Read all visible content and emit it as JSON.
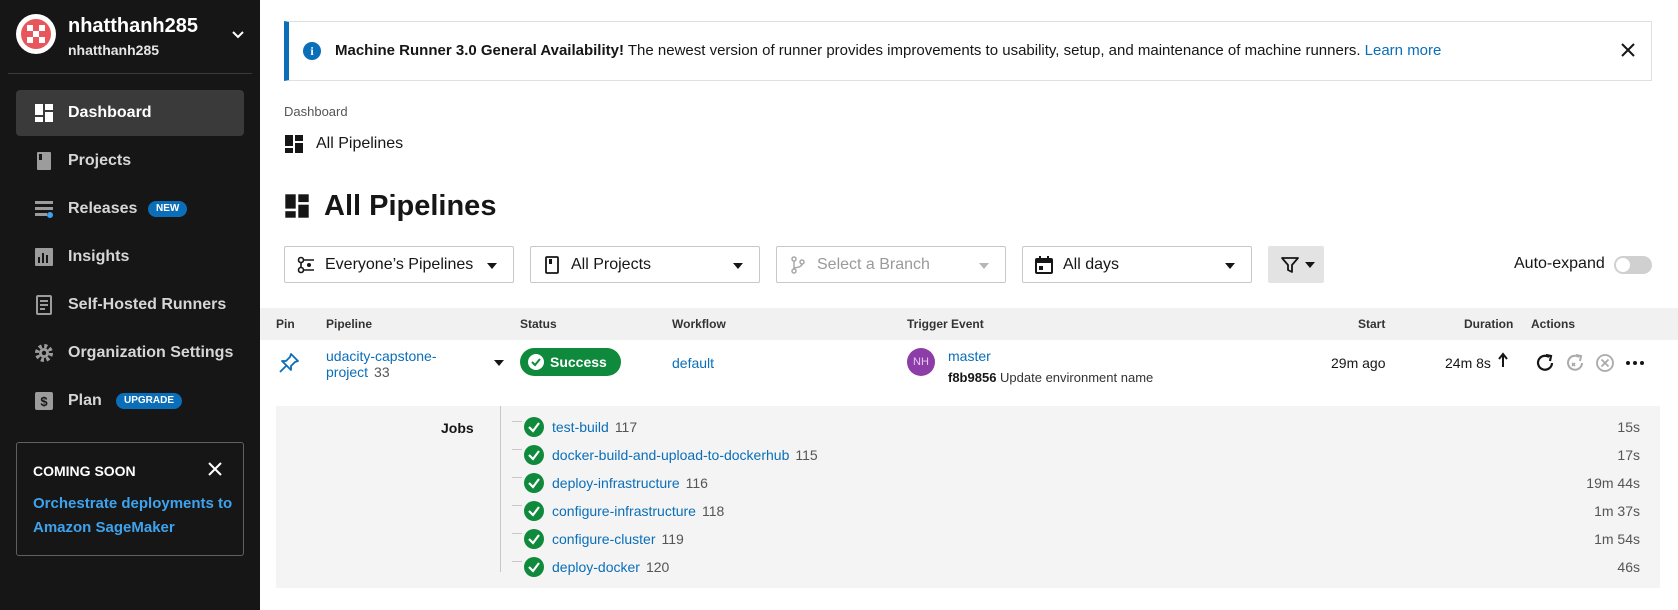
{
  "org": {
    "name": "nhatthanh285",
    "sub": "nhatthanh285"
  },
  "sidebar": {
    "items": [
      {
        "label": "Dashboard",
        "icon": "dashboard-icon",
        "active": true
      },
      {
        "label": "Projects",
        "icon": "book-icon"
      },
      {
        "label": "Releases",
        "icon": "releases-icon",
        "badge": "NEW"
      },
      {
        "label": "Insights",
        "icon": "chart-icon"
      },
      {
        "label": "Self-Hosted Runners",
        "icon": "runner-icon"
      },
      {
        "label": "Organization Settings",
        "icon": "gear-icon"
      },
      {
        "label": "Plan",
        "icon": "dollar-icon",
        "badge": "UPGRADE"
      }
    ],
    "coming_soon": {
      "title": "COMING SOON",
      "link": "Orchestrate deployments to Amazon SageMaker"
    }
  },
  "banner": {
    "bold": "Machine Runner 3.0 General Availability!",
    "text": " The newest version of runner provides improvements to usability, setup, and maintenance of machine runners. ",
    "link": "Learn more"
  },
  "breadcrumb": "Dashboard",
  "sub_title": "All Pipelines",
  "page_title": "All Pipelines",
  "filters": {
    "pipelines": "Everyone’s Pipelines",
    "projects": "All Projects",
    "branch_placeholder": "Select a Branch",
    "days": "All days"
  },
  "auto_expand": {
    "label": "Auto-expand",
    "on": false
  },
  "table": {
    "headers": [
      "Pin",
      "Pipeline",
      "Status",
      "Workflow",
      "Trigger Event",
      "Start",
      "Duration",
      "Actions"
    ],
    "row": {
      "pipeline": "udacity-capstone-project",
      "number": "33",
      "status": "Success",
      "workflow": "default",
      "avatar": "NH",
      "branch": "master",
      "commit_sha": "f8b9856",
      "commit_msg": "Update environment name",
      "start": "29m ago",
      "duration": "24m 8s"
    }
  },
  "jobs": {
    "label": "Jobs",
    "items": [
      {
        "name": "test-build",
        "number": "117",
        "duration": "15s"
      },
      {
        "name": "docker-build-and-upload-to-dockerhub",
        "number": "115",
        "duration": "17s"
      },
      {
        "name": "deploy-infrastructure",
        "number": "116",
        "duration": "19m 44s"
      },
      {
        "name": "configure-infrastructure",
        "number": "118",
        "duration": "1m 37s"
      },
      {
        "name": "configure-cluster",
        "number": "119",
        "duration": "1m 54s"
      },
      {
        "name": "deploy-docker",
        "number": "120",
        "duration": "46s"
      }
    ]
  },
  "colors": {
    "sidebar": "#161616",
    "accent": "#0a6eb9",
    "success": "#0f8a3c",
    "link_dark": "#3ea3ee"
  }
}
